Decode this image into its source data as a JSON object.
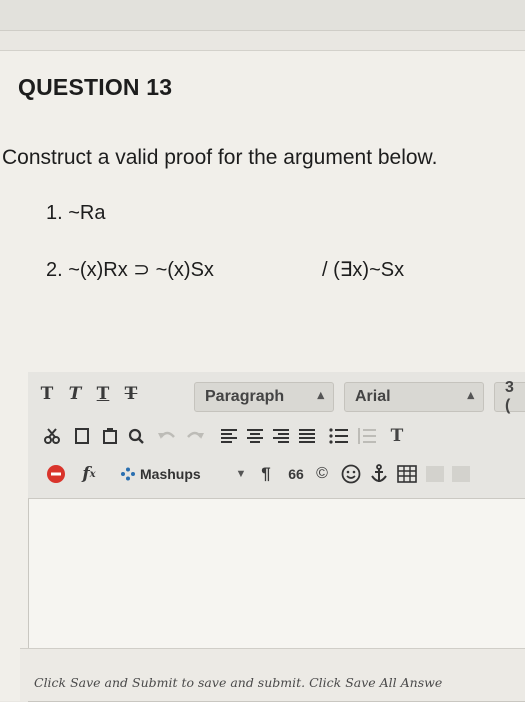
{
  "question": {
    "title": "QUESTION 13",
    "prompt": "Construct a valid proof for the argument below.",
    "premises": [
      {
        "num": "1.",
        "text": "~Ra"
      },
      {
        "num": "2.",
        "text": "~(x)Rx ⊃ ~(x)Sx"
      }
    ],
    "conclusion": "/ (∃x)~Sx"
  },
  "toolbar": {
    "text_styles": [
      "T",
      "T",
      "T",
      "T"
    ],
    "paragraph_label": "Paragraph",
    "font_label": "Arial",
    "size_label": "3 (",
    "mashups_label": "Mashups",
    "pilcrow": "¶",
    "quote": "66",
    "copyright": "©"
  },
  "footer": {
    "note": "Click Save and Submit to save and submit. Click Save All Answe"
  },
  "colors": {
    "spellcheck_red": "#d9342b",
    "mashups_icon": "#2a6fb0"
  }
}
